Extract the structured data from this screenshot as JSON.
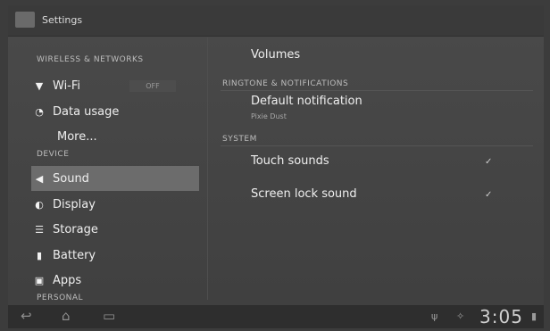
{
  "app": {
    "title": "Settings"
  },
  "left": {
    "sections": {
      "wireless": "WIRELESS & NETWORKS",
      "device": "DEVICE",
      "personal": "PERSONAL"
    },
    "items": [
      {
        "label": "Wi-Fi",
        "icon": "wifi-icon"
      },
      {
        "label": "Data usage",
        "icon": "data-usage-icon"
      },
      {
        "label": "More...",
        "icon": ""
      },
      {
        "label": "Sound",
        "icon": "speaker-icon"
      },
      {
        "label": "Display",
        "icon": "display-icon"
      },
      {
        "label": "Storage",
        "icon": "storage-icon"
      },
      {
        "label": "Battery",
        "icon": "battery-icon"
      },
      {
        "label": "Apps",
        "icon": "apps-icon"
      }
    ],
    "wifi_toggle": "OFF"
  },
  "right": {
    "volumes": "Volumes",
    "section_ringtone": "RINGTONE & NOTIFICATIONS",
    "default_notification": "Default notification",
    "default_notification_value": "Pixie Dust",
    "section_system": "SYSTEM",
    "touch_sounds": "Touch sounds",
    "screen_lock_sound": "Screen lock sound"
  },
  "status": {
    "time": "3:05"
  }
}
